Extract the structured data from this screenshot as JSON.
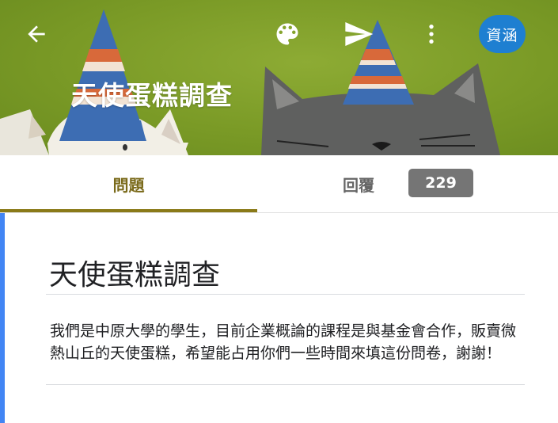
{
  "header": {
    "title": "天使蛋糕調查",
    "avatar_text": "資涵"
  },
  "tabs": [
    {
      "label": "問題",
      "selected": true
    },
    {
      "label": "回覆",
      "selected": false,
      "count": "229"
    }
  ],
  "form": {
    "title": "天使蛋糕調查",
    "description": "我們是中原大學的學生，目前企業概論的課程是與基金會合作，販賣微熱山丘的天使蛋糕，希望能占用你們一些時間來填這份問卷，謝謝！"
  },
  "icons": {
    "back": "arrow-back-icon",
    "theme": "palette-icon",
    "send": "send-icon",
    "more": "more-vert-icon"
  },
  "colors": {
    "banner_green": "#7a9a26",
    "tab_accent": "#8a7a18",
    "avatar_blue": "#1e7fd1",
    "left_accent": "#4285f4",
    "badge_gray": "#757575"
  }
}
